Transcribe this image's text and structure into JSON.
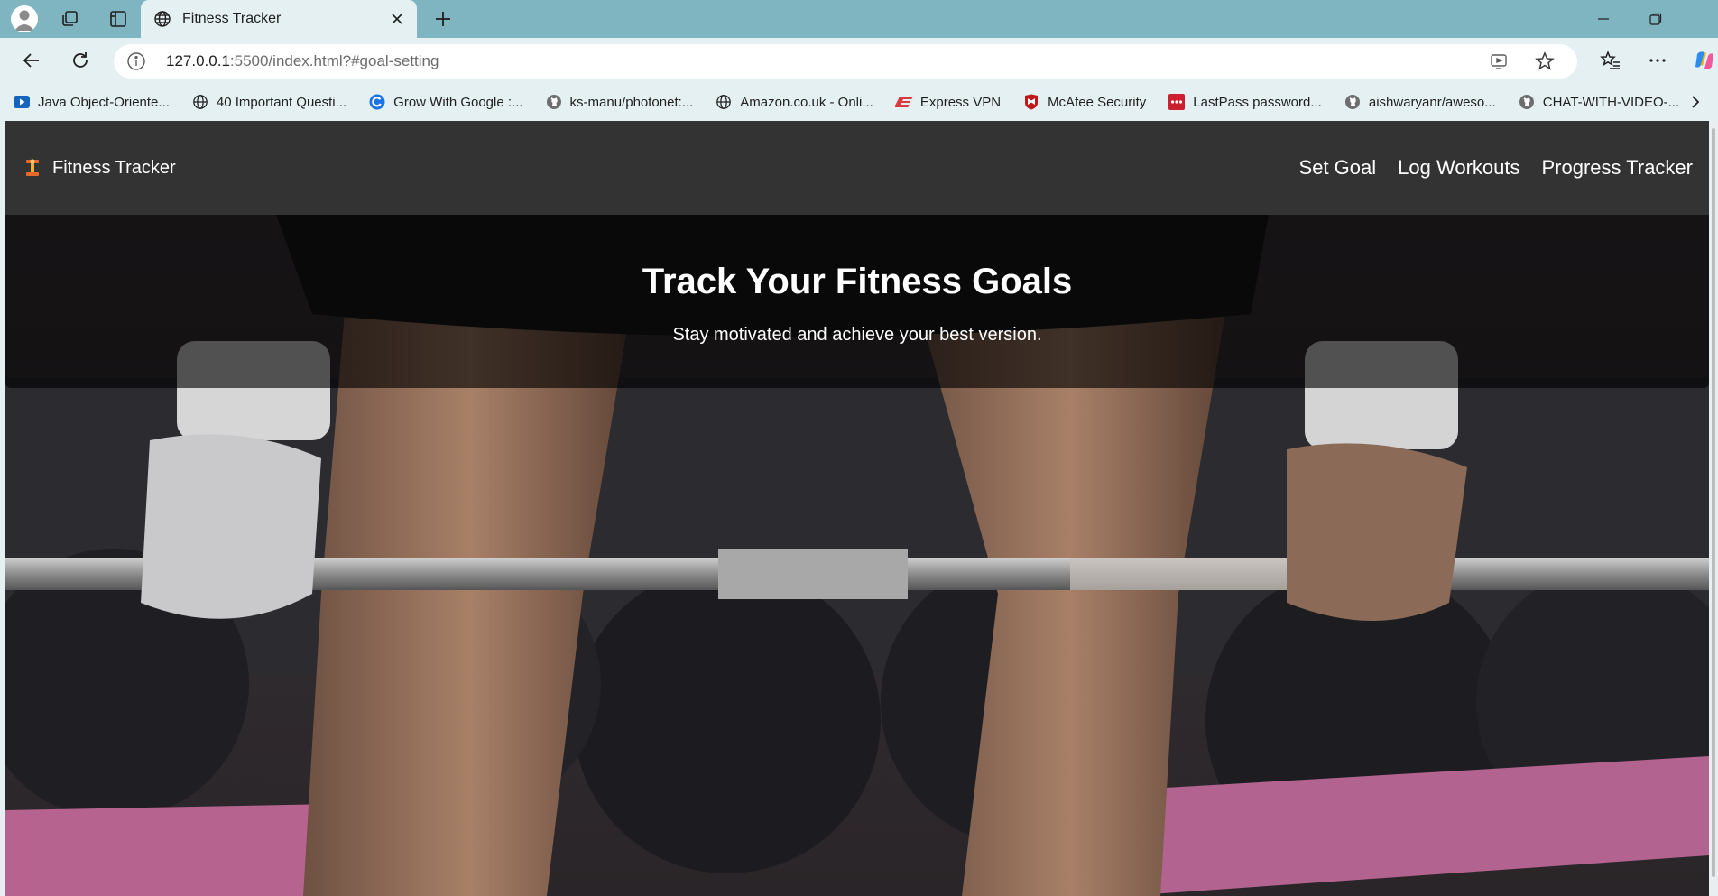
{
  "browser": {
    "tab": {
      "title": "Fitness Tracker"
    },
    "address": {
      "host": "127.0.0.1",
      "rest": ":5500/index.html?#goal-setting"
    },
    "bookmarks": [
      {
        "label": "Java Object-Oriente...",
        "icon": "youtube-icon"
      },
      {
        "label": "40 Important Questi...",
        "icon": "globe-icon"
      },
      {
        "label": "Grow With Google :...",
        "icon": "google-icon"
      },
      {
        "label": "ks-manu/photonet:...",
        "icon": "github-icon"
      },
      {
        "label": "Amazon.co.uk - Onli...",
        "icon": "globe-icon"
      },
      {
        "label": "Express VPN",
        "icon": "expressvpn-icon"
      },
      {
        "label": "McAfee Security",
        "icon": "mcafee-icon"
      },
      {
        "label": "LastPass password...",
        "icon": "lastpass-icon"
      },
      {
        "label": "aishwaryanr/aweso...",
        "icon": "github-icon"
      },
      {
        "label": "CHAT-WITH-VIDEO-...",
        "icon": "github-icon"
      }
    ]
  },
  "site": {
    "brand": {
      "name": "Fitness Tracker",
      "icon": "dumbbell-emoji-icon"
    },
    "nav": [
      {
        "label": "Set Goal"
      },
      {
        "label": "Log Workouts"
      },
      {
        "label": "Progress Tracker"
      }
    ],
    "hero": {
      "title": "Track Your Fitness Goals",
      "subtitle": "Stay motivated and achieve your best version.",
      "background": "deadlift-barbell-photo"
    }
  },
  "colors": {
    "tabstrip": "#7fb5c1",
    "toolbar": "#e5f0f3",
    "nav_bg": "#333333",
    "hero_overlay": "rgba(0,0,0,0.62)",
    "text_light": "#ffffff"
  }
}
